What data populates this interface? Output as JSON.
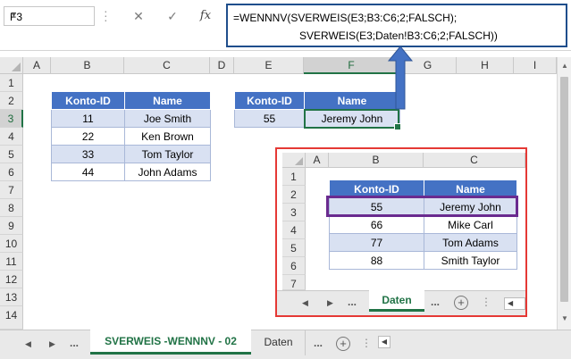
{
  "formula_bar": {
    "name_box": "F3",
    "cancel_glyph": "✕",
    "confirm_glyph": "✓",
    "fx_label": "fx",
    "formula_line1": "=WENNNV(SVERWEIS(E3;B3:C6;2;FALSCH);",
    "formula_line2": "SVERWEIS(E3;Daten!B3:C6;2;FALSCH))"
  },
  "columns": [
    "A",
    "B",
    "C",
    "D",
    "E",
    "F",
    "G",
    "H",
    "I"
  ],
  "rows": [
    "1",
    "2",
    "3",
    "4",
    "5",
    "6",
    "7",
    "8",
    "9",
    "10",
    "11",
    "12",
    "13",
    "14"
  ],
  "main_table": {
    "headers": [
      "Konto-ID",
      "Name"
    ],
    "rows": [
      [
        "11",
        "Joe Smith"
      ],
      [
        "22",
        "Ken Brown"
      ],
      [
        "33",
        "Tom Taylor"
      ],
      [
        "44",
        "John Adams"
      ]
    ]
  },
  "lookup_table": {
    "headers": [
      "Konto-ID",
      "Name"
    ],
    "row": [
      "55",
      "Jeremy John"
    ]
  },
  "inset": {
    "columns": [
      "A",
      "B",
      "C"
    ],
    "rows": [
      "1",
      "2",
      "3",
      "4",
      "5",
      "6",
      "7"
    ],
    "headers": [
      "Konto-ID",
      "Name"
    ],
    "data": [
      [
        "55",
        "Jeremy John"
      ],
      [
        "66",
        "Mike Carl"
      ],
      [
        "77",
        "Tom Adams"
      ],
      [
        "88",
        "Smith Taylor"
      ]
    ],
    "tab_active": "Daten",
    "tab_dots": "..."
  },
  "sheet_tabs": {
    "active": "SVERWEIS -WENNNV - 02",
    "other": "Daten",
    "dots": "...",
    "plus": "+"
  },
  "colors": {
    "accent": "#217346",
    "header_blue": "#4472c4",
    "band_blue": "#d9e1f2",
    "inset_border": "#e53935",
    "highlight_purple": "#6a2b8f",
    "arrow_blue": "#4472c4"
  }
}
